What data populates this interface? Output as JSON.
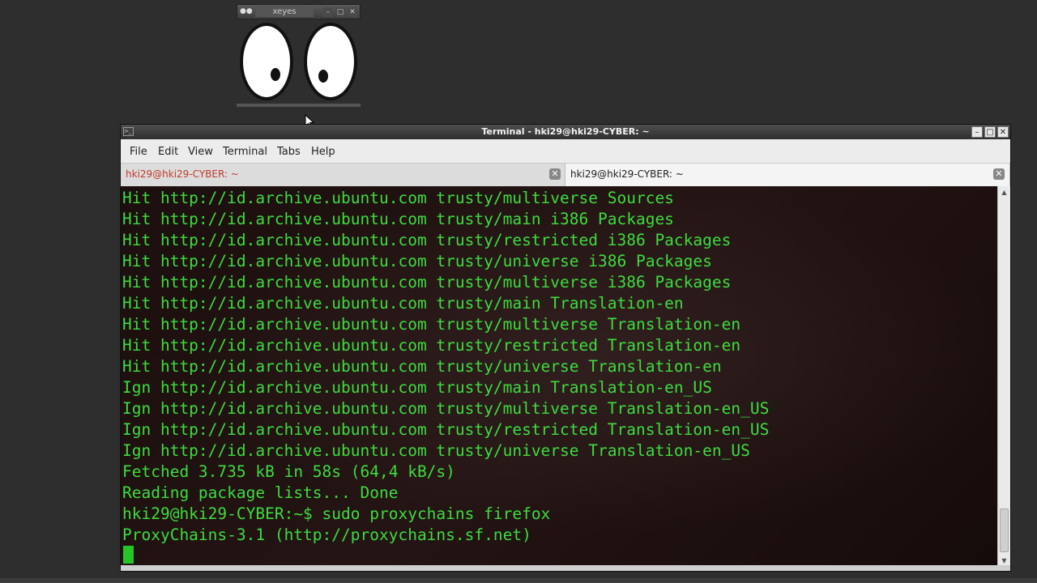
{
  "xeyes": {
    "title": "xeyes",
    "buttons": [
      "–",
      "□",
      "✕"
    ]
  },
  "terminal": {
    "title": "Terminal - hki29@hki29-CYBER: ~",
    "window_buttons": [
      "–",
      "□",
      "✕"
    ],
    "menu": [
      "File",
      "Edit",
      "View",
      "Terminal",
      "Tabs",
      "Help"
    ],
    "tabs": [
      {
        "label": "hki29@hki29-CYBER: ~",
        "active": false
      },
      {
        "label": "hki29@hki29-CYBER: ~",
        "active": true
      }
    ],
    "lines": [
      "Hit http://id.archive.ubuntu.com trusty/multiverse Sources",
      "Hit http://id.archive.ubuntu.com trusty/main i386 Packages",
      "Hit http://id.archive.ubuntu.com trusty/restricted i386 Packages",
      "Hit http://id.archive.ubuntu.com trusty/universe i386 Packages",
      "Hit http://id.archive.ubuntu.com trusty/multiverse i386 Packages",
      "Hit http://id.archive.ubuntu.com trusty/main Translation-en",
      "Hit http://id.archive.ubuntu.com trusty/multiverse Translation-en",
      "Hit http://id.archive.ubuntu.com trusty/restricted Translation-en",
      "Hit http://id.archive.ubuntu.com trusty/universe Translation-en",
      "Ign http://id.archive.ubuntu.com trusty/main Translation-en_US",
      "Ign http://id.archive.ubuntu.com trusty/multiverse Translation-en_US",
      "Ign http://id.archive.ubuntu.com trusty/restricted Translation-en_US",
      "Ign http://id.archive.ubuntu.com trusty/universe Translation-en_US",
      "Fetched 3.735 kB in 58s (64,4 kB/s)",
      "Reading package lists... Done",
      "hki29@hki29-CYBER:~$ sudo proxychains firefox",
      "ProxyChains-3.1 (http://proxychains.sf.net)"
    ],
    "text_color": "#3ddc3d"
  }
}
